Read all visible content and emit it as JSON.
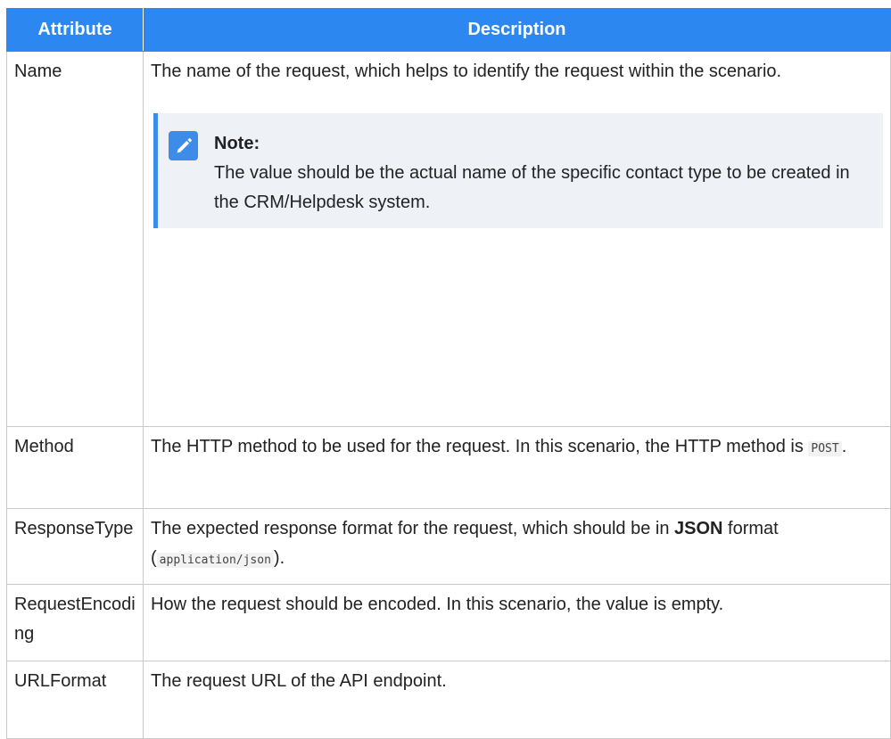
{
  "header": {
    "attribute": "Attribute",
    "description": "Description"
  },
  "rows": [
    {
      "attribute": "Name",
      "description": "The name of the request, which helps to identify the request within the scenario.",
      "note": {
        "title": "Note:",
        "text": "The value should be the actual name of the specific contact type to be created in the CRM/Helpdesk system.",
        "icon": "pencil-icon"
      }
    },
    {
      "attribute": "Method",
      "description_pre": "The HTTP method to be used for the request. In this scenario, the HTTP method is ",
      "code": "POST",
      "description_post": "."
    },
    {
      "attribute": "ResponseType",
      "description_pre": "The expected response format for the request, which should be in ",
      "bold": "JSON",
      "description_mid": " format (",
      "code": "application/json",
      "description_post": ")."
    },
    {
      "attribute": "RequestEncoding",
      "description": "How the request should be encoded. In this scenario, the value is empty."
    },
    {
      "attribute": "URLFormat",
      "description": "The request URL of the API endpoint."
    }
  ],
  "colors": {
    "header_bg": "#2d87f0",
    "note_accent": "#3e8ce9",
    "note_bg": "#eef1f5"
  }
}
